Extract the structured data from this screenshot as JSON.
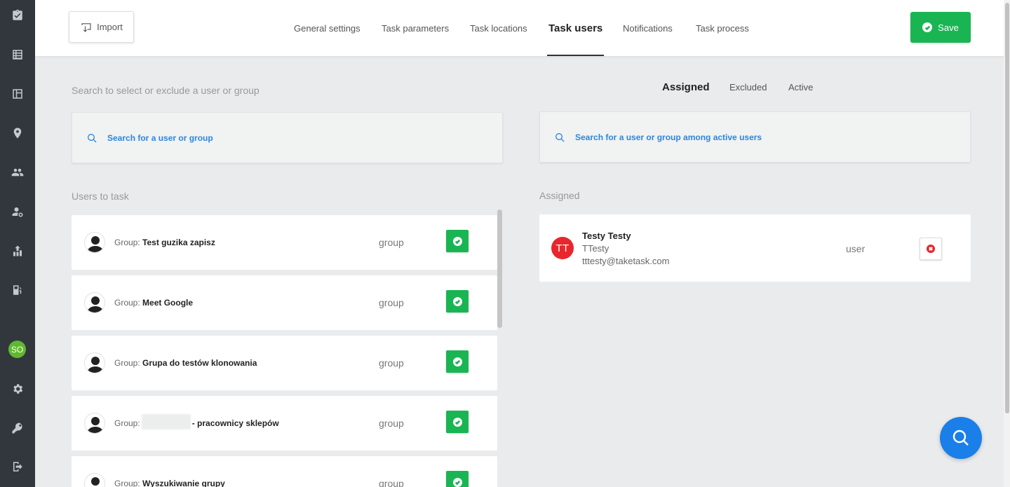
{
  "sidebar": {
    "items": [
      {
        "icon": "clipboard-check-icon"
      },
      {
        "icon": "list-icon"
      },
      {
        "icon": "layout-icon"
      },
      {
        "icon": "map-pin-icon"
      },
      {
        "icon": "users-icon"
      },
      {
        "icon": "user-settings-icon"
      },
      {
        "icon": "chart-upload-icon"
      },
      {
        "icon": "fuel-icon"
      },
      {
        "icon": "gear-icon"
      },
      {
        "icon": "key-icon"
      },
      {
        "icon": "logout-icon"
      }
    ],
    "user_initials": "SO"
  },
  "header": {
    "import_label": "Import",
    "tabs": [
      {
        "label": "General settings",
        "active": false
      },
      {
        "label": "Task parameters",
        "active": false
      },
      {
        "label": "Task locations",
        "active": false
      },
      {
        "label": "Task users",
        "active": true
      },
      {
        "label": "Notifications",
        "active": false
      },
      {
        "label": "Task process",
        "active": false
      }
    ],
    "save_label": "Save"
  },
  "left": {
    "search_title": "Search to select or exclude a user or group",
    "search_placeholder": "Search for a user or group",
    "list_label": "Users to task",
    "group_prefix": "Group:",
    "rows": [
      {
        "name": "Test guzika zapisz",
        "type": "group"
      },
      {
        "name": "Meet Google",
        "type": "group"
      },
      {
        "name": "Grupa do testów klonowania",
        "type": "group"
      },
      {
        "name": "- pracownicy sklepów",
        "type": "group",
        "redacted": true
      },
      {
        "name": "Wyszukiwanie grupy",
        "type": "group"
      }
    ]
  },
  "right": {
    "filter_tabs": [
      {
        "label": "Assigned",
        "active": true
      },
      {
        "label": "Excluded",
        "active": false
      },
      {
        "label": "Active",
        "active": false
      }
    ],
    "search_placeholder": "Search for a user or group among active users",
    "list_label": "Assigned",
    "assigned": [
      {
        "initials": "TT",
        "name": "Testy Testy",
        "login": "TTesty",
        "email": "tttesty@taketask.com",
        "type": "user"
      }
    ]
  },
  "colors": {
    "sidebar": "#32373d",
    "accent_green": "#1ab553",
    "link_blue": "#2a86e0",
    "fab_blue": "#1a7fe8",
    "danger_red": "#e8262b"
  }
}
